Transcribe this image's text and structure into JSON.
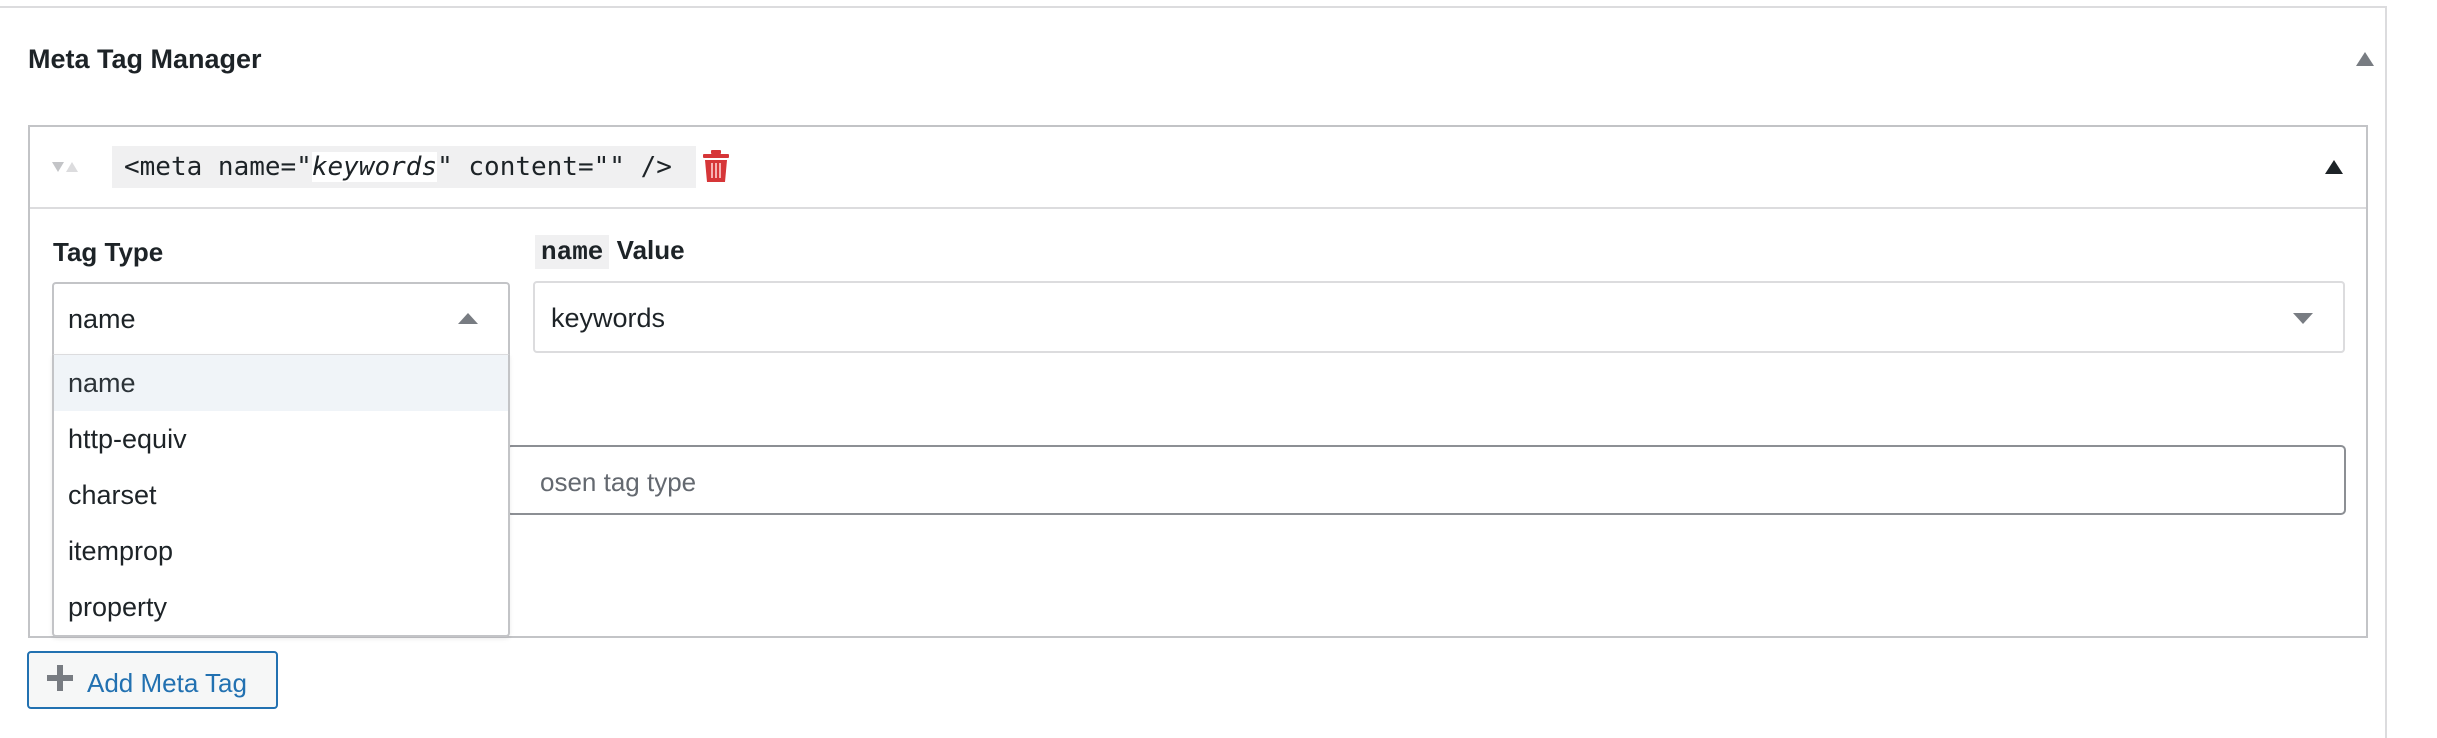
{
  "metabox": {
    "title": "Meta Tag Manager"
  },
  "tag": {
    "preview_prefix": "<meta name=\"",
    "preview_keyword": "keywords",
    "preview_suffix": "\" content=\"\" />"
  },
  "fields": {
    "type_label": "Tag Type",
    "value_label_chip": "name",
    "value_label_text": "Value",
    "type_selected": "name",
    "value_selected": "keywords",
    "content_placeholder_visible": "osen tag type"
  },
  "dropdown": {
    "options": [
      "name",
      "http-equiv",
      "charset",
      "itemprop",
      "property"
    ]
  },
  "actions": {
    "add_label": "Add Meta Tag"
  },
  "icons": {
    "sort": "sort-arrows-icon",
    "delete": "trash-icon",
    "add": "plus-icon"
  },
  "colors": {
    "accent": "#2271b1",
    "delete": "#d63638",
    "border": "#c3c4c7"
  }
}
